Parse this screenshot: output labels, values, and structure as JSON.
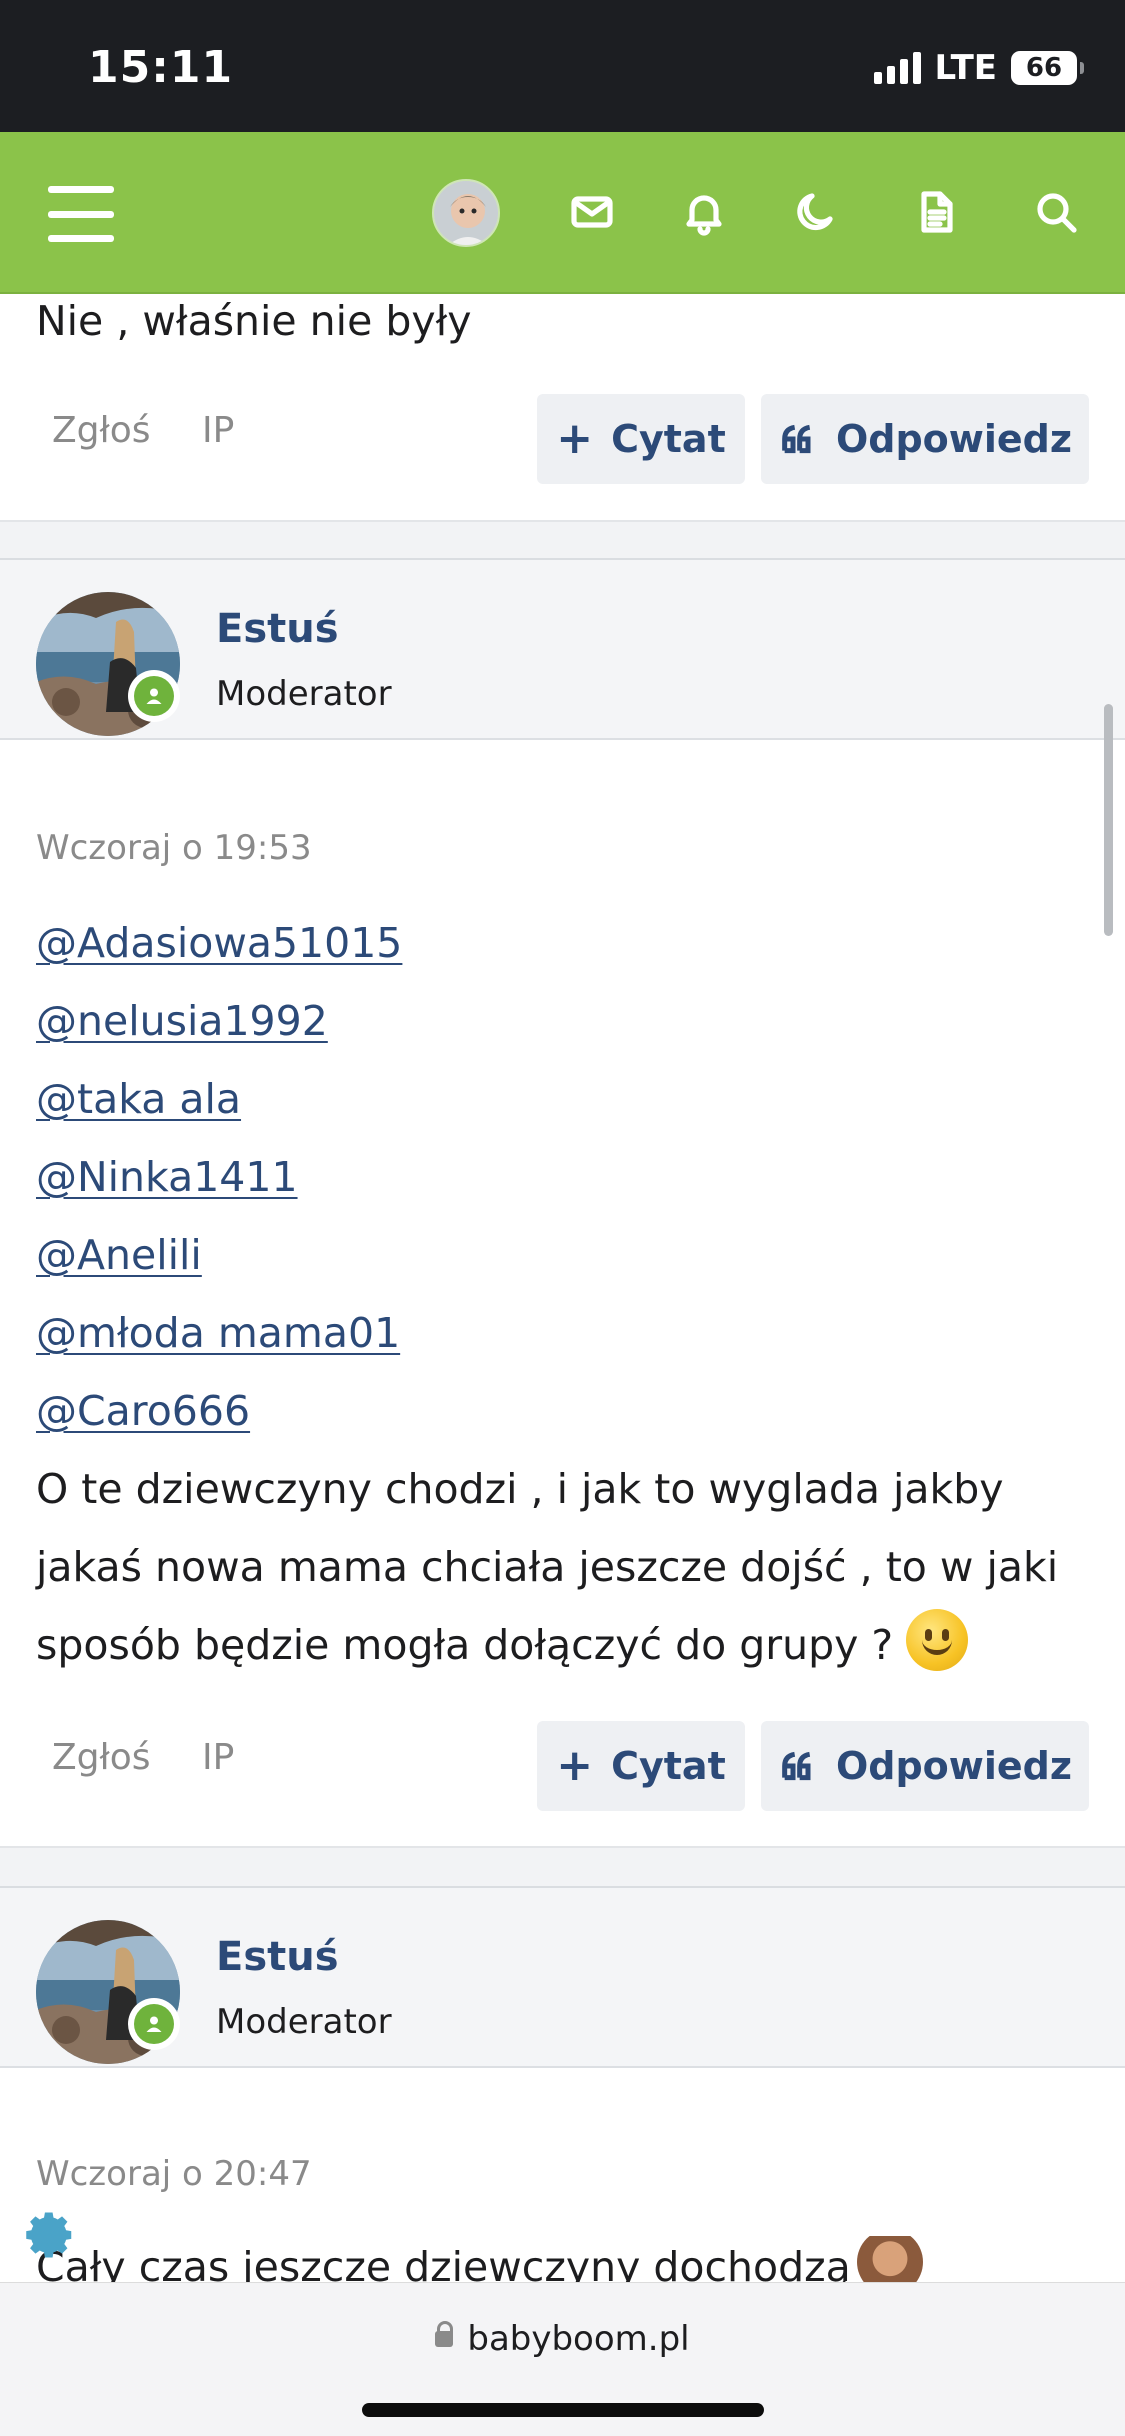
{
  "status_bar": {
    "time": "15:11",
    "network": "LTE",
    "battery": "66"
  },
  "nav": {
    "icons": [
      "menu-icon",
      "avatar",
      "mail-icon",
      "bell-icon",
      "moon-icon",
      "document-icon",
      "search-icon"
    ],
    "accent_color": "#8bc34a"
  },
  "post_prev": {
    "text": "Nie , właśnie nie były",
    "report_label": "Zgłoś",
    "ip_label": "IP",
    "quote_label": "Cytat",
    "reply_label": "Odpowiedz"
  },
  "post1": {
    "username": "Estuś",
    "role": "Moderator",
    "timestamp": "Wczoraj o 19:53",
    "mentions": [
      "@Adasiowa51015",
      "@nelusia1992",
      "@taka ala",
      "@Ninka1411",
      "@Anelili",
      "@młoda mama01",
      "@Caro666"
    ],
    "text_lines": [
      "O te dziewczyny chodzi , i jak to wyglada jakby",
      "jakaś nowa mama chciała jeszcze dojść , to w jaki",
      "sposób będzie mogła dołączyć do grupy ?"
    ],
    "report_label": "Zgłoś",
    "ip_label": "IP",
    "quote_label": "Cytat",
    "reply_label": "Odpowiedz"
  },
  "post2": {
    "username": "Estuś",
    "role": "Moderator",
    "timestamp": "Wczoraj o 20:47",
    "text": "Cały czas jeszcze dziewczyny dochodzą"
  },
  "browser": {
    "url": "babyboom.pl"
  }
}
